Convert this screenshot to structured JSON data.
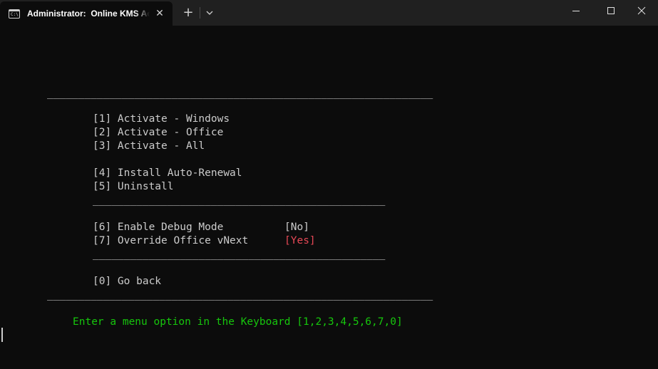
{
  "window": {
    "tab_title": "Administrator:  Online KMS Activation",
    "tab_icon": "terminal-icon",
    "icons": {
      "close_tab": "close-icon",
      "new_tab": "plus-icon",
      "dropdown": "chevron-down-icon",
      "minimize": "minimize-icon",
      "maximize": "maximize-icon",
      "close_window": "close-icon"
    },
    "tab_close_glyph": "✕",
    "new_tab_glyph": "+"
  },
  "terminal": {
    "colors": {
      "background": "#0c0c0c",
      "text": "#cccccc",
      "prompt": "#16c60c",
      "highlight": "#e74856"
    },
    "separator_long": "______________________________________________________________",
    "separator_short": "_______________________________________________",
    "menu": {
      "item1": "[1] Activate - Windows",
      "item2": "[2] Activate - Office",
      "item3": "[3] Activate - All",
      "item4": "[4] Install Auto-Renewal",
      "item5": "[5] Uninstall",
      "item6": "[6] Enable Debug Mode",
      "item6_value": "[No]",
      "item7": "[7] Override Office vNext",
      "item7_value": "[Yes]",
      "item0": "[0] Go back"
    },
    "prompt": "Enter a menu option in the Keyboard [1,2,3,4,5,6,7,0]"
  }
}
